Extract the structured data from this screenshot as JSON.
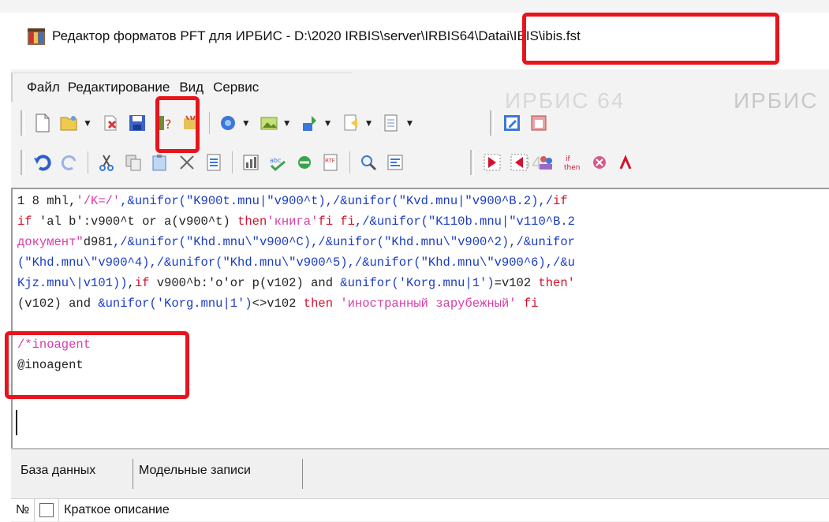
{
  "window": {
    "title": "Редактор форматов PFT для ИРБИС - D:\\2020 IRBIS\\server\\IRBIS64\\Datai\\IBIS\\ibis.fst"
  },
  "menu": {
    "items": [
      "Файл",
      "Редактирование",
      "Вид",
      "Сервис"
    ]
  },
  "background_ghost_text": [
    "ИРБИС",
    "64",
    "ИРБИС 64"
  ],
  "editor": {
    "lines": [
      [
        {
          "t": "1 8 mhl,",
          "c": "black"
        },
        {
          "t": "'/K=/'",
          "c": "pink"
        },
        {
          "t": ",&unifor(",
          "c": "blue"
        },
        {
          "t": "\"K900t.mnu|\"v900^t)",
          "c": "blue"
        },
        {
          "t": ",/&unifor(",
          "c": "blue"
        },
        {
          "t": "\"Kvd.mnu|\"v900^B.2)",
          "c": "blue"
        },
        {
          "t": ",/",
          "c": "blue"
        },
        {
          "t": "if",
          "c": "red"
        }
      ],
      [
        {
          "t": "if",
          "c": "red"
        },
        {
          "t": " 'al b':v900^t or a(v900^t) ",
          "c": "black"
        },
        {
          "t": "then",
          "c": "red"
        },
        {
          "t": "'книга'",
          "c": "pink"
        },
        {
          "t": "fi fi",
          "c": "red"
        },
        {
          "t": ",/&unifor(",
          "c": "blue"
        },
        {
          "t": "\"K110b.mnu|\"v110^B.2",
          "c": "blue"
        }
      ],
      [
        {
          "t": "документ\"",
          "c": "pink"
        },
        {
          "t": "d981",
          "c": "black"
        },
        {
          "t": ",/&unifor(",
          "c": "blue"
        },
        {
          "t": "\"Khd.mnu\\\"v900^C)",
          "c": "blue"
        },
        {
          "t": ",/&unifor(",
          "c": "blue"
        },
        {
          "t": "\"Khd.mnu\\\"v900^2)",
          "c": "blue"
        },
        {
          "t": ",/&unifor",
          "c": "blue"
        }
      ],
      [
        {
          "t": "(\"Khd.mnu\\\"v900^4)",
          "c": "blue"
        },
        {
          "t": ",/&unifor(",
          "c": "blue"
        },
        {
          "t": "\"Khd.mnu\\\"v900^5)",
          "c": "blue"
        },
        {
          "t": ",/&unifor(",
          "c": "blue"
        },
        {
          "t": "\"Khd.mnu\\\"v900^6)",
          "c": "blue"
        },
        {
          "t": ",/&u",
          "c": "blue"
        }
      ],
      [
        {
          "t": "Kjz.mnu\\|v101))",
          "c": "blue"
        },
        {
          "t": ",",
          "c": "black"
        },
        {
          "t": "if",
          "c": "red"
        },
        {
          "t": " v900^b:'o'or p(v102) and ",
          "c": "black"
        },
        {
          "t": "&unifor('Korg.mnu|1')",
          "c": "blue"
        },
        {
          "t": "=v102 ",
          "c": "black"
        },
        {
          "t": "then'",
          "c": "red"
        }
      ],
      [
        {
          "t": "(v102) and ",
          "c": "black"
        },
        {
          "t": "&unifor('Korg.mnu|1')",
          "c": "blue"
        },
        {
          "t": "<>v102 ",
          "c": "black"
        },
        {
          "t": "then",
          "c": "red"
        },
        {
          "t": " 'иностранный зарубежный'",
          "c": "pink"
        },
        {
          "t": " fi",
          "c": "red"
        }
      ],
      [],
      [
        {
          "t": "/*inoagent",
          "c": "pink"
        }
      ],
      [
        {
          "t": "@inoagent",
          "c": "black"
        }
      ]
    ]
  },
  "bottom_tabs": [
    "База данных",
    "Модельные записи"
  ],
  "list_header": {
    "number": "№",
    "description": "Краткое описание"
  },
  "colors": {
    "red": "#d4122e",
    "blue": "#1a3cc4",
    "pink": "#d83ca6",
    "black": "#222222",
    "highlight": "#e8141b"
  }
}
